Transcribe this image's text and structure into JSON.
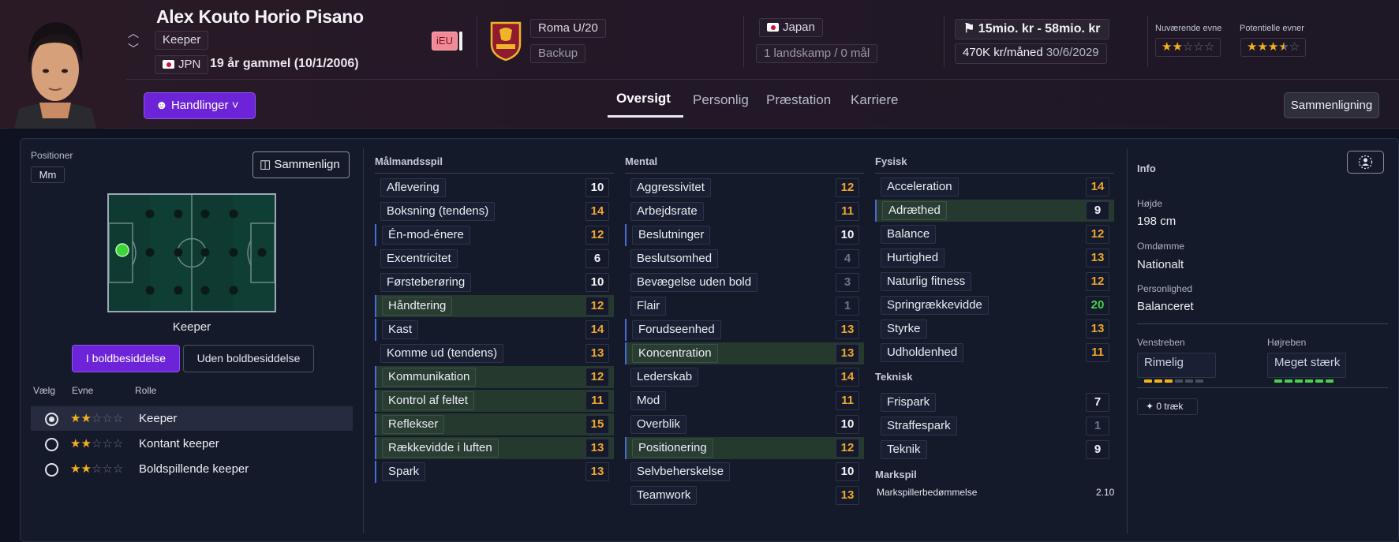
{
  "player": {
    "name": "Alex Kouto Horio Pisano",
    "position": "Keeper",
    "nation_code": "JPN",
    "age_text": "19 år gammel (10/1/2006)",
    "eu_badge": "iEU"
  },
  "club": {
    "team": "Roma U/20",
    "squad_status": "Backup"
  },
  "nationality": {
    "country": "Japan",
    "caps": "1 landskamp / 0 mål"
  },
  "contract": {
    "value_range": "15mio. kr - 58mio. kr",
    "wage": "470K kr/måned",
    "expiry": "30/6/2029"
  },
  "ability": {
    "current_label": "Nuværende evne",
    "current_stars": 2,
    "potential_label": "Potentielle evner",
    "potential_stars": 3.5
  },
  "actions": {
    "button_label": "Handlinger"
  },
  "tabs": [
    "Oversigt",
    "Personlig",
    "Præstation",
    "Karriere"
  ],
  "compare_top": "Sammenligning",
  "positions": {
    "label": "Positioner",
    "code": "Mm",
    "compare_button": "Sammenlign",
    "pitch_label": "Keeper",
    "in_possession": "I boldbesiddelse",
    "out_possession": "Uden boldbesiddelse",
    "col_select": "Vælg",
    "col_ability": "Evne",
    "col_role": "Rolle",
    "roles": [
      {
        "name": "Keeper",
        "stars": 2,
        "selected": true
      },
      {
        "name": "Kontant keeper",
        "stars": 2,
        "selected": false
      },
      {
        "name": "Boldspillende keeper",
        "stars": 2,
        "selected": false
      }
    ]
  },
  "goalkeeping": {
    "title": "Målmandsspil",
    "attrs": [
      {
        "name": "Aflevering",
        "value": "10",
        "color": "white",
        "hl": false,
        "mk": false
      },
      {
        "name": "Boksning (tendens)",
        "value": "14",
        "color": "orange",
        "hl": false,
        "mk": false
      },
      {
        "name": "Én-mod-énere",
        "value": "12",
        "color": "orange",
        "hl": false,
        "mk": true
      },
      {
        "name": "Excentricitet",
        "value": "6",
        "color": "white",
        "hl": false,
        "mk": false
      },
      {
        "name": "Førsteberøring",
        "value": "10",
        "color": "white",
        "hl": false,
        "mk": false
      },
      {
        "name": "Håndtering",
        "value": "12",
        "color": "orange",
        "hl": true,
        "mk": true
      },
      {
        "name": "Kast",
        "value": "14",
        "color": "orange",
        "hl": false,
        "mk": true
      },
      {
        "name": "Komme ud (tendens)",
        "value": "13",
        "color": "orange",
        "hl": false,
        "mk": false
      },
      {
        "name": "Kommunikation",
        "value": "12",
        "color": "orange",
        "hl": true,
        "mk": true
      },
      {
        "name": "Kontrol af feltet",
        "value": "11",
        "color": "orange",
        "hl": true,
        "mk": true
      },
      {
        "name": "Reflekser",
        "value": "15",
        "color": "orange",
        "hl": true,
        "mk": true
      },
      {
        "name": "Rækkevidde i luften",
        "value": "13",
        "color": "orange",
        "hl": true,
        "mk": true
      },
      {
        "name": "Spark",
        "value": "13",
        "color": "orange",
        "hl": false,
        "mk": true
      }
    ]
  },
  "mental": {
    "title": "Mental",
    "attrs": [
      {
        "name": "Aggressivitet",
        "value": "12",
        "color": "orange",
        "hl": false,
        "mk": false
      },
      {
        "name": "Arbejdsrate",
        "value": "11",
        "color": "orange",
        "hl": false,
        "mk": false
      },
      {
        "name": "Beslutninger",
        "value": "10",
        "color": "white",
        "hl": false,
        "mk": true
      },
      {
        "name": "Beslutsomhed",
        "value": "4",
        "color": "grey",
        "hl": false,
        "mk": false
      },
      {
        "name": "Bevægelse uden bold",
        "value": "3",
        "color": "grey",
        "hl": false,
        "mk": false
      },
      {
        "name": "Flair",
        "value": "1",
        "color": "grey",
        "hl": false,
        "mk": false
      },
      {
        "name": "Forudseenhed",
        "value": "13",
        "color": "orange",
        "hl": false,
        "mk": true
      },
      {
        "name": "Koncentration",
        "value": "13",
        "color": "orange",
        "hl": true,
        "mk": true
      },
      {
        "name": "Lederskab",
        "value": "14",
        "color": "orange",
        "hl": false,
        "mk": false
      },
      {
        "name": "Mod",
        "value": "11",
        "color": "orange",
        "hl": false,
        "mk": false
      },
      {
        "name": "Overblik",
        "value": "10",
        "color": "white",
        "hl": false,
        "mk": false
      },
      {
        "name": "Positionering",
        "value": "12",
        "color": "orange",
        "hl": true,
        "mk": true
      },
      {
        "name": "Selvbeherskelse",
        "value": "10",
        "color": "white",
        "hl": false,
        "mk": false
      },
      {
        "name": "Teamwork",
        "value": "13",
        "color": "orange",
        "hl": false,
        "mk": false
      }
    ]
  },
  "physical": {
    "title": "Fysisk",
    "attrs": [
      {
        "name": "Acceleration",
        "value": "14",
        "color": "orange",
        "hl": false,
        "mk": false
      },
      {
        "name": "Adræthed",
        "value": "9",
        "color": "white",
        "hl": true,
        "mk": true
      },
      {
        "name": "Balance",
        "value": "12",
        "color": "orange",
        "hl": false,
        "mk": false
      },
      {
        "name": "Hurtighed",
        "value": "13",
        "color": "orange",
        "hl": false,
        "mk": false
      },
      {
        "name": "Naturlig fitness",
        "value": "12",
        "color": "orange",
        "hl": false,
        "mk": false
      },
      {
        "name": "Springrækkevidde",
        "value": "20",
        "color": "green",
        "hl": false,
        "mk": false
      },
      {
        "name": "Styrke",
        "value": "13",
        "color": "orange",
        "hl": false,
        "mk": false
      },
      {
        "name": "Udholdenhed",
        "value": "11",
        "color": "orange",
        "hl": false,
        "mk": false
      }
    ]
  },
  "technical": {
    "title": "Teknisk",
    "attrs": [
      {
        "name": "Frispark",
        "value": "7",
        "color": "white",
        "hl": false,
        "mk": false
      },
      {
        "name": "Straffespark",
        "value": "1",
        "color": "grey",
        "hl": false,
        "mk": false
      },
      {
        "name": "Teknik",
        "value": "9",
        "color": "white",
        "hl": false,
        "mk": false
      }
    ]
  },
  "outfield": {
    "title": "Markspil",
    "label": "Markspillerbedømmelse",
    "value": "2.10"
  },
  "info": {
    "title": "Info",
    "height_label": "Højde",
    "height": "198 cm",
    "reputation_label": "Omdømme",
    "reputation": "Nationalt",
    "personality_label": "Personlighed",
    "personality": "Balanceret",
    "left_foot_label": "Venstreben",
    "left_foot": "Rimelig",
    "left_foot_level": 3,
    "right_foot_label": "Højreben",
    "right_foot": "Meget stærk",
    "right_foot_level": 6,
    "traits": "0 træk"
  },
  "colors": {
    "accent": "#6d24d8",
    "orange": "#f0a62b",
    "green": "#48d44a",
    "star": "#f3b21d"
  }
}
